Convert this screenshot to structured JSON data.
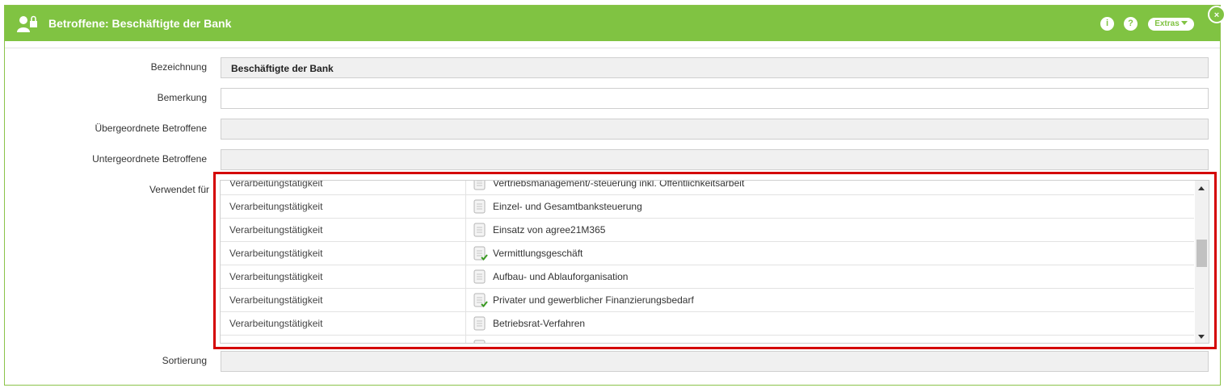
{
  "dialog": {
    "title": "Betroffene: Beschäftigte der Bank",
    "info_label": "i",
    "help_label": "?",
    "extras_label": "Extras",
    "close_label": "×",
    "accent_color": "#80c342"
  },
  "form": {
    "bezeichnung_label": "Bezeichnung",
    "bezeichnung_value": "Beschäftigte der Bank",
    "bemerkung_label": "Bemerkung",
    "bemerkung_value": "",
    "uebergeordnete_label": "Übergeordnete Betroffene",
    "uebergeordnete_value": "",
    "untergeordnete_label": "Untergeordnete Betroffene",
    "untergeordnete_value": "",
    "verwendet_label": "Verwendet für",
    "sortierung_label": "Sortierung",
    "sortierung_value": ""
  },
  "verwendet_rows": [
    {
      "type": "Verarbeitungstätigkeit",
      "name": "Vertriebsmanagement/-steuerung inkl. Öffentlichkeitsarbeit",
      "icon": "document-icon",
      "checked": false
    },
    {
      "type": "Verarbeitungstätigkeit",
      "name": "Einzel- und Gesamtbanksteuerung",
      "icon": "document-icon",
      "checked": false
    },
    {
      "type": "Verarbeitungstätigkeit",
      "name": "Einsatz von agree21M365",
      "icon": "document-icon",
      "checked": false
    },
    {
      "type": "Verarbeitungstätigkeit",
      "name": "Vermittlungsgeschäft",
      "icon": "document-check-icon",
      "checked": true
    },
    {
      "type": "Verarbeitungstätigkeit",
      "name": "Aufbau- und Ablauforganisation",
      "icon": "document-icon",
      "checked": false
    },
    {
      "type": "Verarbeitungstätigkeit",
      "name": "Privater und gewerblicher Finanzierungsbedarf",
      "icon": "document-check-icon",
      "checked": true
    },
    {
      "type": "Verarbeitungstätigkeit",
      "name": "Betriebsrat-Verfahren",
      "icon": "document-icon",
      "checked": false
    }
  ],
  "highlight_color": "#d40000"
}
